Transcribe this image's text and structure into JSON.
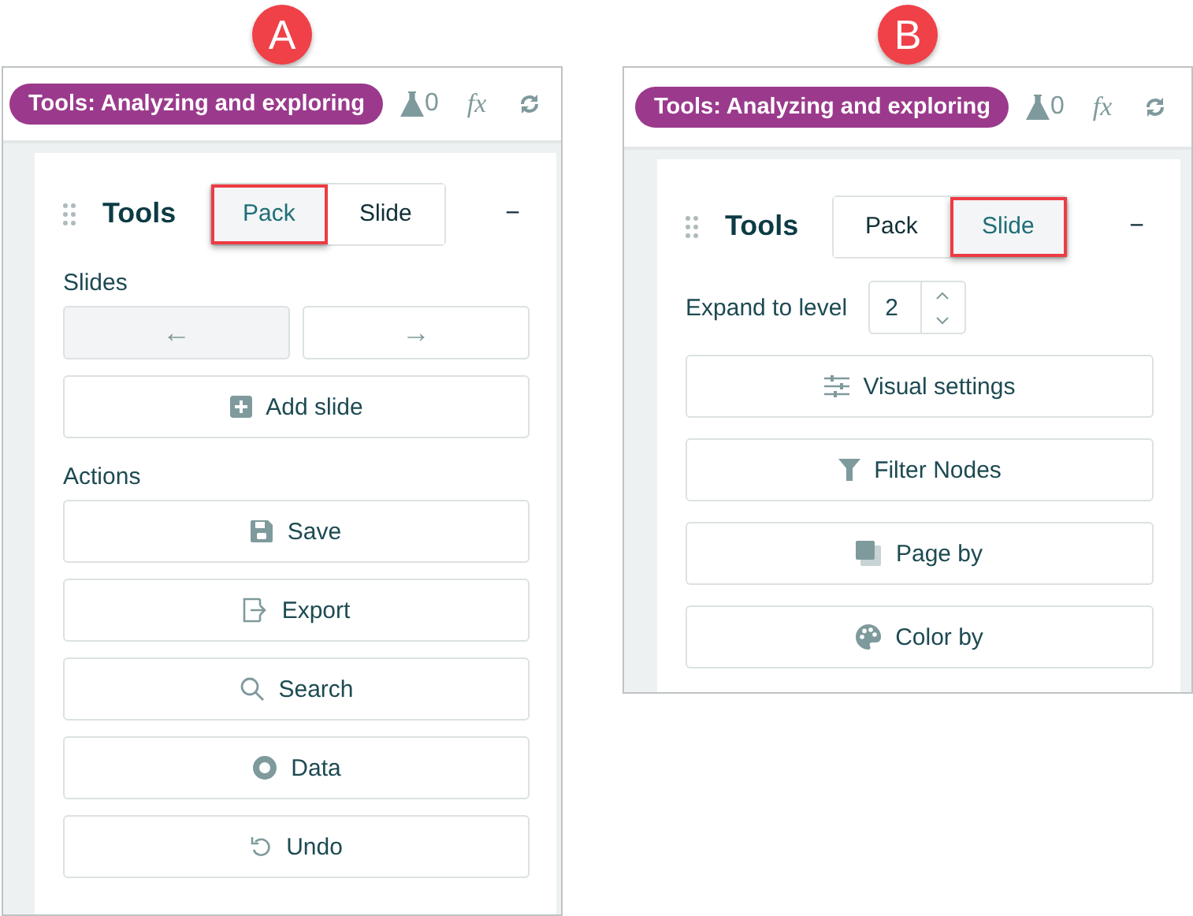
{
  "panels": [
    {
      "badge": "A",
      "chip": "Tools: Analyzing and exploring",
      "flask_count": "0",
      "fx": "fx",
      "title": "Tools",
      "collapse": "−",
      "tabs": [
        {
          "label": "Pack",
          "selected": true,
          "annotated": true
        },
        {
          "label": "Slide",
          "selected": false,
          "annotated": false
        }
      ],
      "items": [
        {
          "kind": "label",
          "text": "Slides"
        },
        {
          "kind": "nav",
          "prev": {
            "label": "←",
            "disabled": true
          },
          "next": {
            "label": "→",
            "disabled": false
          }
        },
        {
          "kind": "add",
          "label": "Add slide"
        },
        {
          "kind": "label",
          "text": "Actions"
        },
        {
          "kind": "save",
          "label": "Save"
        },
        {
          "kind": "export",
          "label": "Export"
        },
        {
          "kind": "search",
          "label": "Search"
        },
        {
          "kind": "data",
          "label": "Data"
        },
        {
          "kind": "undo",
          "label": "Undo"
        }
      ]
    },
    {
      "badge": "B",
      "chip": "Tools: Analyzing and exploring",
      "flask_count": "0",
      "fx": "fx",
      "title": "Tools",
      "collapse": "−",
      "tabs": [
        {
          "label": "Pack",
          "selected": false,
          "annotated": false
        },
        {
          "label": "Slide",
          "selected": true,
          "annotated": true
        }
      ],
      "items": [
        {
          "kind": "stepper",
          "label": "Expand to level",
          "value": "2"
        },
        {
          "kind": "visual",
          "label": "Visual settings"
        },
        {
          "kind": "filter",
          "label": "Filter Nodes"
        },
        {
          "kind": "page",
          "label": "Page by"
        },
        {
          "kind": "color",
          "label": "Color by"
        }
      ]
    }
  ]
}
